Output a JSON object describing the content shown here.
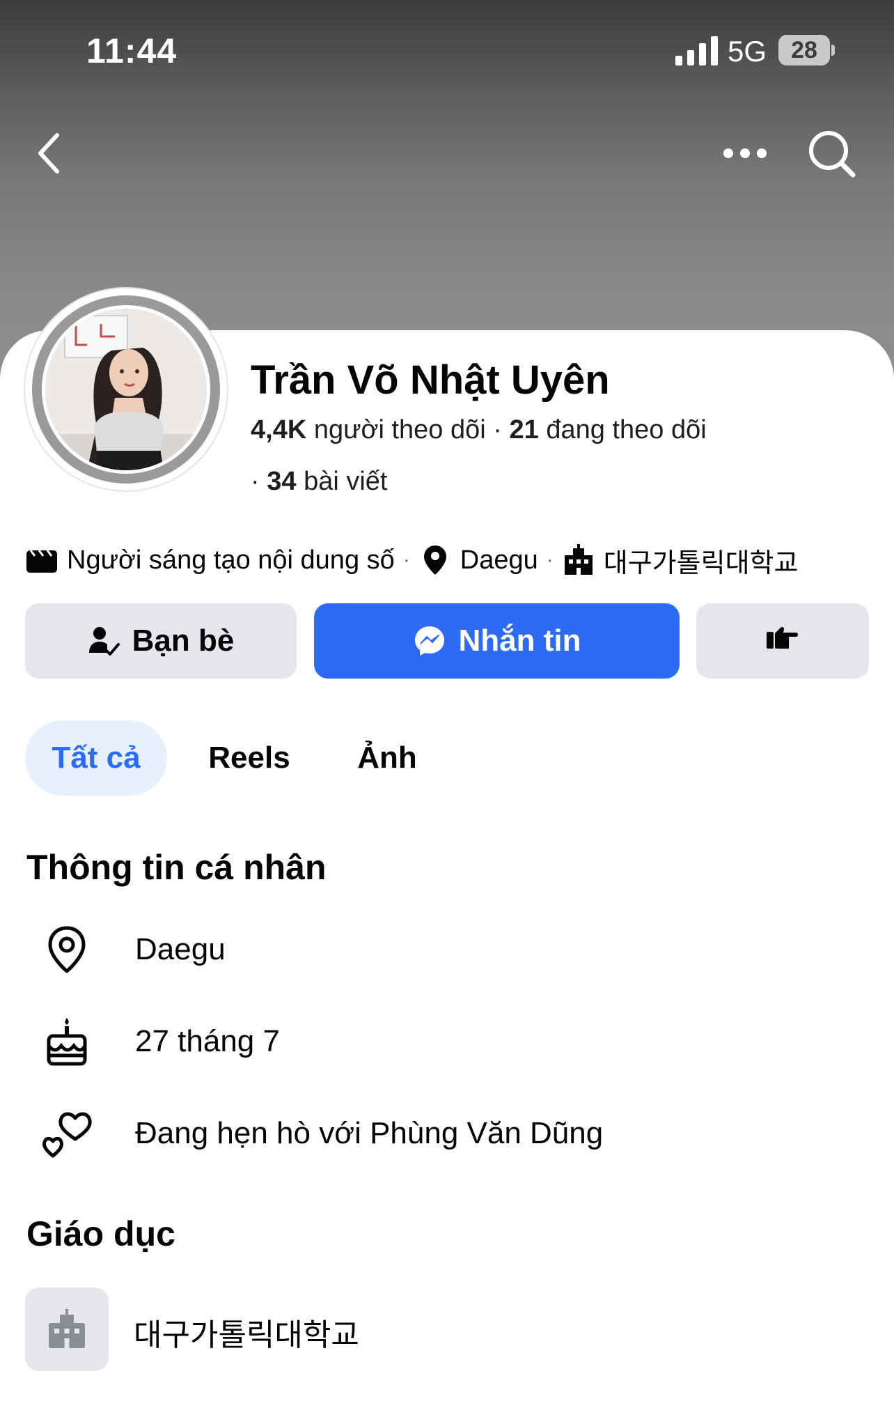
{
  "status_bar": {
    "time": "11:44",
    "network": "5G",
    "battery": "28"
  },
  "header": {
    "back_icon": "chevron-left-icon",
    "more_icon": "ellipsis-icon",
    "search_icon": "search-icon"
  },
  "profile": {
    "name": "Trần Võ Nhật Uyên",
    "followers_count": "4,4K",
    "followers_label": "người theo dõi",
    "separator": "·",
    "following_count": "21",
    "following_label": "đang theo dõi",
    "posts_count": "34",
    "posts_label": "bài viết"
  },
  "info_line": {
    "creator_icon": "clapperboard-icon",
    "creator": "Người sáng tạo nội dung số",
    "dot": "·",
    "location_icon": "map-pin-icon",
    "location": "Daegu",
    "school_icon": "building-icon",
    "school": "대구가톨릭대학교"
  },
  "actions": {
    "friends": "Bạn bè",
    "message": "Nhắn tin",
    "poke_icon": "pointing-hand-icon"
  },
  "tabs": [
    {
      "label": "Tất cả",
      "active": true
    },
    {
      "label": "Reels",
      "active": false
    },
    {
      "label": "Ảnh",
      "active": false
    }
  ],
  "personal_info": {
    "title": "Thông tin cá nhân",
    "items": [
      {
        "icon": "map-pin-icon",
        "text": "Daegu"
      },
      {
        "icon": "birthday-cake-icon",
        "text": "27 tháng 7"
      },
      {
        "icon": "hearts-icon",
        "text": "Đang hẹn hò với Phùng Văn Dũng"
      }
    ]
  },
  "education": {
    "title": "Giáo dục",
    "icon": "building-icon",
    "school": "대구가톨릭대학교"
  },
  "colors": {
    "accent": "#2d6bf5",
    "button_gray": "#e4e6eb",
    "tab_active_bg": "#e7f0fd"
  }
}
